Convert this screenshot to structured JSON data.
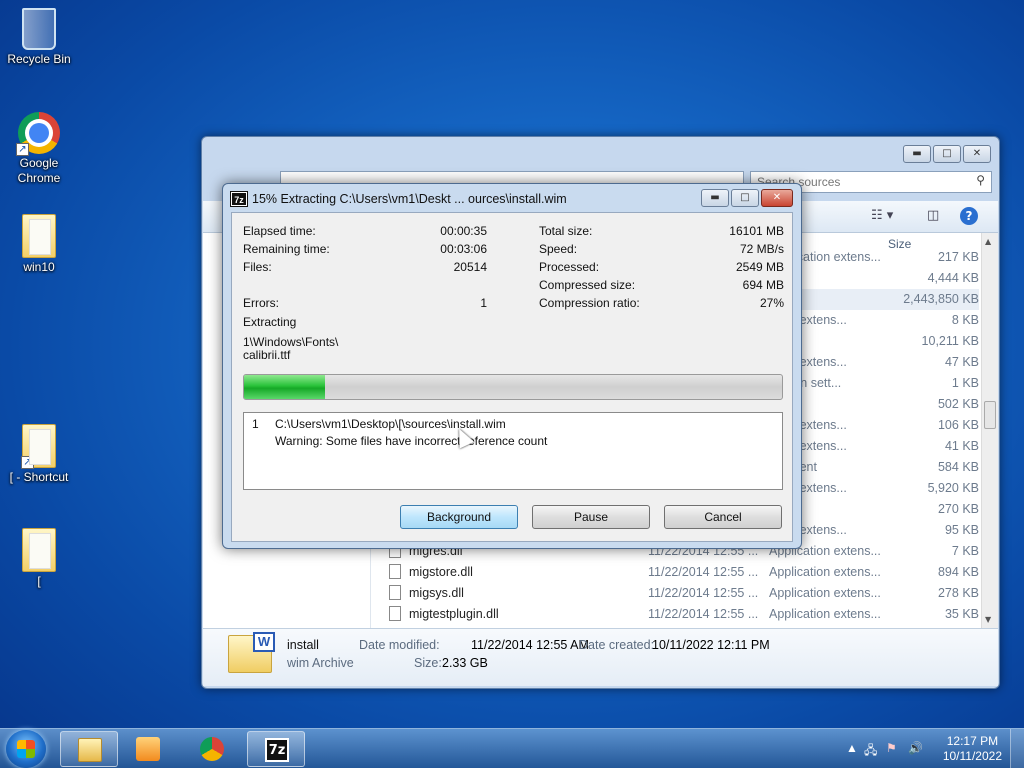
{
  "desktop": {
    "icons": [
      {
        "label": "Recycle Bin"
      },
      {
        "label": "Google Chrome"
      },
      {
        "label": "win10"
      },
      {
        "label": "[ - Shortcut"
      },
      {
        "label": "["
      }
    ]
  },
  "explorer": {
    "search_placeholder": "Search sources",
    "column_size": "Size",
    "files_top": [
      {
        "type": "Application extens...",
        "size": "217 KB"
      },
      {
        "type": "ation",
        "size": "4,444 KB"
      },
      {
        "type": "rchive",
        "size": "2,443,850 KB",
        "selected": true
      },
      {
        "type": "ation extens...",
        "size": "8 KB"
      },
      {
        "type": "ation",
        "size": "10,211 KB"
      },
      {
        "type": "ation extens...",
        "size": "47 KB"
      },
      {
        "type": "uration sett...",
        "size": "1 KB"
      },
      {
        "type": "e",
        "size": "502 KB"
      },
      {
        "type": "ation extens...",
        "size": "106 KB"
      },
      {
        "type": "ation extens...",
        "size": "41 KB"
      },
      {
        "type": "ocument",
        "size": "584 KB"
      },
      {
        "type": "ation extens...",
        "size": "5,920 KB"
      },
      {
        "type": "ation",
        "size": "270 KB"
      },
      {
        "type": "ation extens...",
        "size": "95 KB"
      }
    ],
    "files_bottom": [
      {
        "name": "migres.dll",
        "date": "11/22/2014 12:55 ...",
        "type": "Application extens...",
        "size": "7 KB"
      },
      {
        "name": "migstore.dll",
        "date": "11/22/2014 12:55 ...",
        "type": "Application extens...",
        "size": "894 KB"
      },
      {
        "name": "migsys.dll",
        "date": "11/22/2014 12:55 ...",
        "type": "Application extens...",
        "size": "278 KB"
      },
      {
        "name": "migtestplugin.dll",
        "date": "11/22/2014 12:55 ...",
        "type": "Application extens...",
        "size": "35 KB"
      }
    ],
    "details": {
      "name": "install",
      "kind": "wim Archive",
      "modified_label": "Date modified:",
      "modified_value": "11/22/2014 12:55 AM",
      "created_label": "Date created:",
      "created_value": "10/11/2022 12:11 PM",
      "size_label": "Size:",
      "size_value": "2.33 GB"
    }
  },
  "dialog": {
    "title": "15% Extracting C:\\Users\\vm1\\Deskt ... ources\\install.wim",
    "app_icon": "7z",
    "stats_left": [
      {
        "label": "Elapsed time:",
        "value": "00:00:35"
      },
      {
        "label": "Remaining time:",
        "value": "00:03:06"
      },
      {
        "label": "Files:",
        "value": "20514"
      },
      {
        "label": "Errors:",
        "value": "1"
      }
    ],
    "stats_right": [
      {
        "label": "Total size:",
        "value": "16101 MB"
      },
      {
        "label": "Speed:",
        "value": "72 MB/s"
      },
      {
        "label": "Processed:",
        "value": "2549 MB"
      },
      {
        "label": "Compressed size:",
        "value": "694 MB"
      },
      {
        "label": "Compression ratio:",
        "value": "27%"
      }
    ],
    "status": "Extracting",
    "current_file_line1": "1\\Windows\\Fonts\\",
    "current_file_line2": "calibrii.ttf",
    "progress_percent": 15,
    "log": {
      "index": "1",
      "path": "C:\\Users\\vm1\\Desktop\\[\\sources\\install.wim",
      "message": "Warning: Some files have incorrect reference count"
    },
    "buttons": {
      "background": "Background",
      "pause": "Pause",
      "cancel": "Cancel"
    }
  },
  "taskbar": {
    "time": "12:17 PM",
    "date": "10/11/2022"
  }
}
